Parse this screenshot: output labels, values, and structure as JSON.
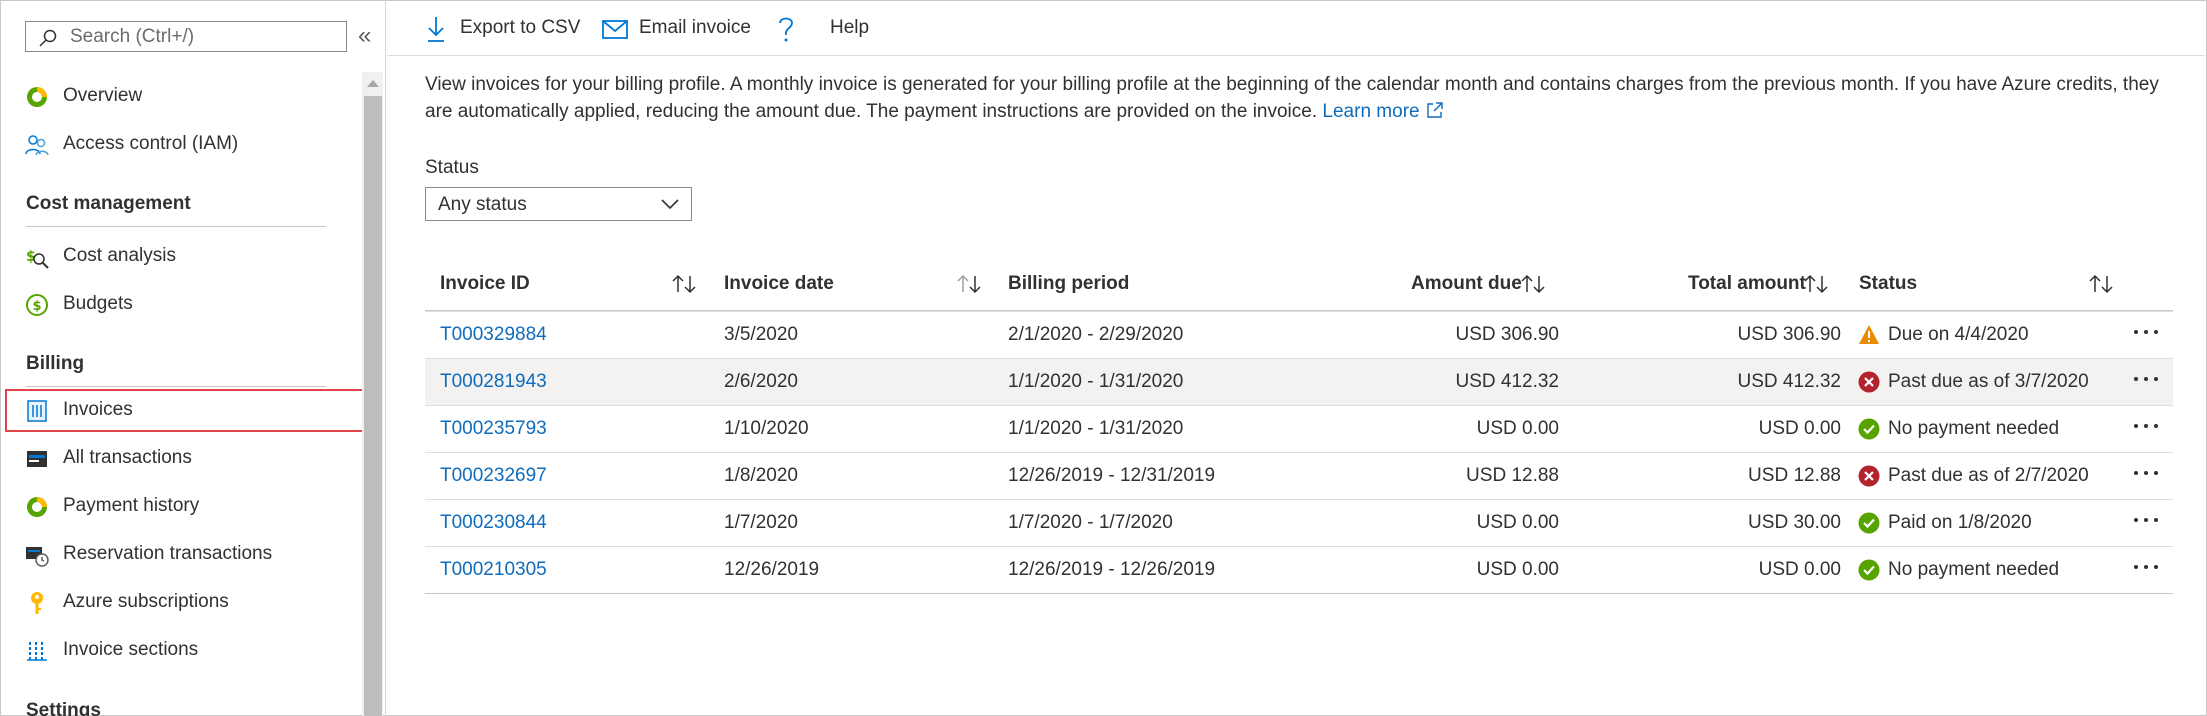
{
  "search": {
    "placeholder": "Search (Ctrl+/)"
  },
  "collapse": "«",
  "sidebar": {
    "items_top": [
      {
        "label": "Overview",
        "icon": "overview-icon"
      },
      {
        "label": "Access control (IAM)",
        "icon": "people-icon"
      }
    ],
    "sections": [
      {
        "title": "Cost management",
        "items": [
          {
            "label": "Cost analysis",
            "icon": "cost-analysis-icon"
          },
          {
            "label": "Budgets",
            "icon": "budgets-icon"
          }
        ]
      },
      {
        "title": "Billing",
        "items": [
          {
            "label": "Invoices",
            "icon": "invoices-icon",
            "selected": true
          },
          {
            "label": "All transactions",
            "icon": "transactions-icon"
          },
          {
            "label": "Payment history",
            "icon": "payment-history-icon"
          },
          {
            "label": "Reservation transactions",
            "icon": "reservation-icon"
          },
          {
            "label": "Azure subscriptions",
            "icon": "key-icon"
          },
          {
            "label": "Invoice sections",
            "icon": "invoice-sections-icon"
          }
        ]
      },
      {
        "title": "Settings",
        "items": []
      }
    ]
  },
  "toolbar": {
    "export_label": "Export to CSV",
    "email_label": "Email invoice",
    "help_label": "Help"
  },
  "description": {
    "text": "View invoices for your billing profile. A monthly invoice is generated for your billing profile at the beginning of the calendar month and contains charges from the previous month. If you have Azure credits, they are automatically applied, reducing the amount due. The payment instructions are provided on the invoice.",
    "link": "Learn more"
  },
  "filter": {
    "label": "Status",
    "value": "Any status"
  },
  "table": {
    "headers": {
      "invoice_id": "Invoice ID",
      "invoice_date": "Invoice date",
      "billing_period": "Billing period",
      "amount_due": "Amount due",
      "total_amount": "Total amount",
      "status": "Status"
    },
    "rows": [
      {
        "id": "T000329884",
        "date": "3/5/2020",
        "period": "2/1/2020 - 2/29/2020",
        "due": "USD 306.90",
        "total": "USD 306.90",
        "status": "Due on 4/4/2020",
        "status_kind": "warning"
      },
      {
        "id": "T000281943",
        "date": "2/6/2020",
        "period": "1/1/2020 - 1/31/2020",
        "due": "USD 412.32",
        "total": "USD 412.32",
        "status": "Past due as of 3/7/2020",
        "status_kind": "error"
      },
      {
        "id": "T000235793",
        "date": "1/10/2020",
        "period": "1/1/2020 - 1/31/2020",
        "due": "USD 0.00",
        "total": "USD 0.00",
        "status": "No payment needed",
        "status_kind": "success"
      },
      {
        "id": "T000232697",
        "date": "1/8/2020",
        "period": "12/26/2019 - 12/31/2019",
        "due": "USD 12.88",
        "total": "USD 12.88",
        "status": "Past due as of 2/7/2020",
        "status_kind": "error"
      },
      {
        "id": "T000230844",
        "date": "1/7/2020",
        "period": "1/7/2020 - 1/7/2020",
        "due": "USD 0.00",
        "total": "USD 30.00",
        "status": "Paid on 1/8/2020",
        "status_kind": "success"
      },
      {
        "id": "T000210305",
        "date": "12/26/2019",
        "period": "12/26/2019 - 12/26/2019",
        "due": "USD 0.00",
        "total": "USD 0.00",
        "status": "No payment needed",
        "status_kind": "success"
      }
    ]
  },
  "colors": {
    "link": "#0f6cbd",
    "warning": "#e88c00",
    "error": "#b3232e",
    "success": "#57a300",
    "selection_border": "#e0454c"
  }
}
